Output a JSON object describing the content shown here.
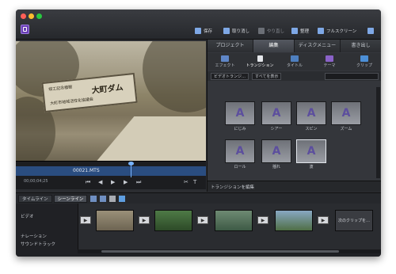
{
  "window": {
    "traffic_colors": [
      "#ff5f57",
      "#febc2e",
      "#28c840"
    ]
  },
  "toolbar": {
    "save_label": "保存",
    "undo_label": "取り消し",
    "redo_label": "やり直し",
    "organize_label": "整理",
    "fullscreen_label": "フルスクリーン"
  },
  "preview": {
    "sign_large_text": "大町ダム",
    "sign_small_text": "竣工記念植樹",
    "sign_small_text2": "大町市地域活性化協議会",
    "clip_name": "00021.MTS",
    "timecode": "00;00;04;25"
  },
  "panel": {
    "tabs": [
      {
        "label": "プロジェクト"
      },
      {
        "label": "編集"
      },
      {
        "label": "ディスクメニュー"
      },
      {
        "label": "書き出し"
      }
    ],
    "subtabs": [
      {
        "label": "エフェクト",
        "icon": "effects-icon"
      },
      {
        "label": "トランジション",
        "icon": "transition-icon"
      },
      {
        "label": "タイトル",
        "icon": "title-icon"
      },
      {
        "label": "テーマ",
        "icon": "theme-icon"
      },
      {
        "label": "クリップ",
        "icon": "clip-icon"
      }
    ],
    "filter1": "ビデオトランジ…",
    "filter2": "すべてを表示",
    "transitions": [
      {
        "label": "にじみ",
        "glyph": "A"
      },
      {
        "label": "シアー",
        "glyph": "A"
      },
      {
        "label": "スピン",
        "glyph": "A"
      },
      {
        "label": "ズーム",
        "glyph": "A"
      },
      {
        "label": "ロール",
        "glyph": "A"
      },
      {
        "label": "揺れ",
        "glyph": "A"
      },
      {
        "label": "波",
        "glyph": "A"
      }
    ],
    "footer_label": "トランジションを編集"
  },
  "timeline": {
    "timeline_tab": "タイムライン",
    "scene_tab": "シーンライン",
    "video_track": "ビデオ",
    "narration_track": "ナレーション",
    "sound_track": "サウンドトラック",
    "next_clip_label": "次のクリップを…"
  }
}
